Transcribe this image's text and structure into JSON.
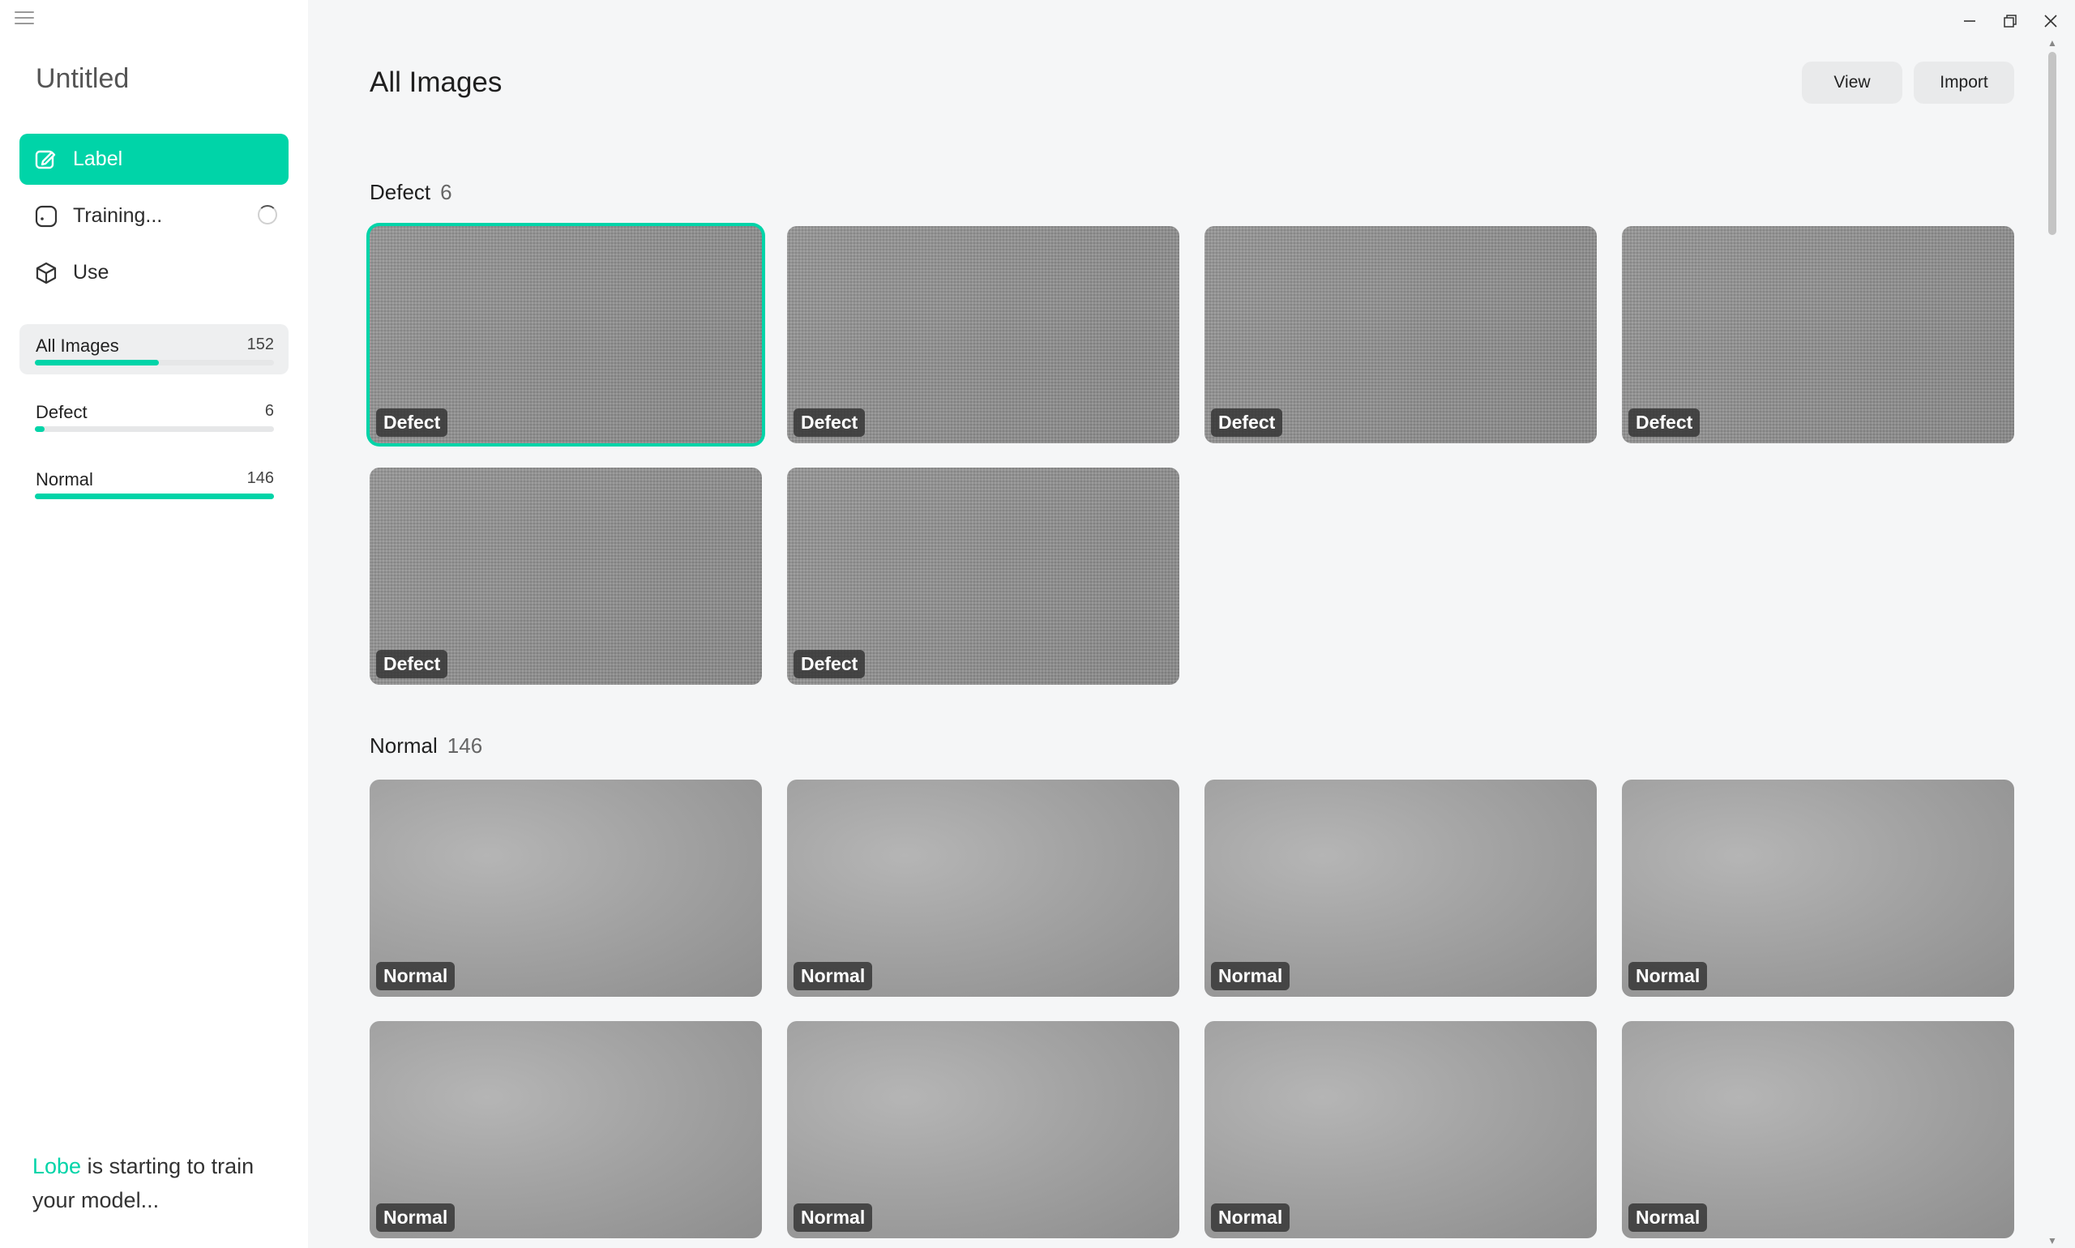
{
  "sidebar": {
    "project_title": "Untitled",
    "nav": [
      {
        "label": "Label",
        "icon": "edit-icon",
        "active": true
      },
      {
        "label": "Training...",
        "icon": "circle-dot-icon",
        "active": false
      },
      {
        "label": "Use",
        "icon": "cube-icon",
        "active": false
      }
    ],
    "filters": [
      {
        "label": "All Images",
        "count": "152",
        "fraction": 0.52
      },
      {
        "label": "Defect",
        "count": "6",
        "fraction": 0.04
      },
      {
        "label": "Normal",
        "count": "146",
        "fraction": 1.0
      }
    ],
    "footer": {
      "brand": "Lobe",
      "text": " is starting to train your model..."
    }
  },
  "header": {
    "title": "All Images",
    "buttons": {
      "view": "View",
      "import": "Import"
    }
  },
  "sections": [
    {
      "title": "Defect",
      "count": "6",
      "label": "Defect",
      "images": [
        "Defect",
        "Defect",
        "Defect",
        "Defect",
        "Defect",
        "Defect"
      ]
    },
    {
      "title": "Normal",
      "count": "146",
      "label": "Normal",
      "images": [
        "Normal",
        "Normal",
        "Normal",
        "Normal",
        "Normal",
        "Normal",
        "Normal",
        "Normal"
      ]
    }
  ],
  "colors": {
    "accent": "#00d4a8"
  }
}
